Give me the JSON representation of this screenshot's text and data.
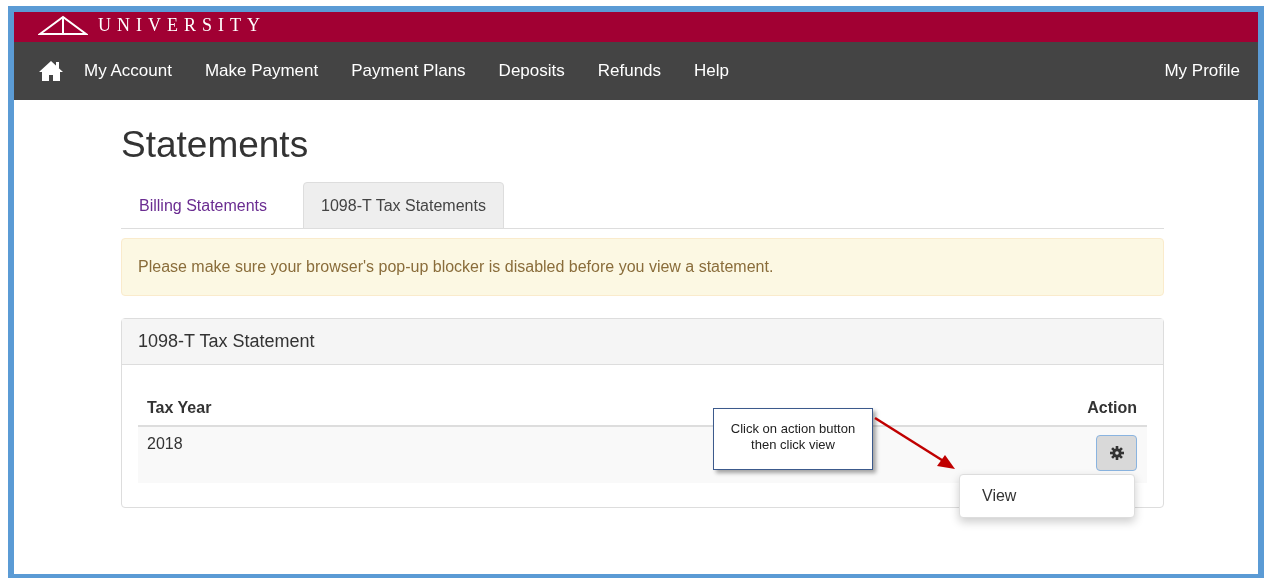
{
  "header": {
    "logo_text": "UNIVERSITY"
  },
  "nav": {
    "items": [
      {
        "label": "My Account"
      },
      {
        "label": "Make Payment"
      },
      {
        "label": "Payment Plans"
      },
      {
        "label": "Deposits"
      },
      {
        "label": "Refunds"
      },
      {
        "label": "Help"
      }
    ],
    "right_item": "My Profile"
  },
  "page_title": "Statements",
  "tabs": [
    {
      "label": "Billing Statements",
      "selected": false
    },
    {
      "label": "1098-T Tax Statements",
      "selected": true
    }
  ],
  "alert": "Please make sure your browser's pop-up blocker is disabled before you view a statement.",
  "panel": {
    "title": "1098-T Tax Statement",
    "columns": [
      "Tax Year",
      "Action"
    ],
    "rows": [
      {
        "tax_year": "2018"
      }
    ],
    "action_menu": [
      "View"
    ]
  },
  "callout": "Click on action button then click view"
}
